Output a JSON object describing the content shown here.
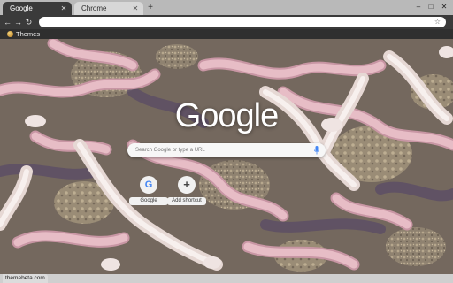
{
  "tabs": [
    {
      "title": "Google",
      "active": true
    },
    {
      "title": "Chrome",
      "active": false
    }
  ],
  "toolbar": {
    "back_icon": "arrow-left-icon",
    "forward_icon": "arrow-right-icon",
    "reload_icon": "reload-icon",
    "omnibox_value": "",
    "star_icon": "star-icon"
  },
  "bookmarks": [
    {
      "label": "Themes",
      "icon": "theme-icon"
    }
  ],
  "ntp": {
    "logo": "Google",
    "search_placeholder": "Search Google or type a URL",
    "shortcuts": [
      {
        "label": "Google",
        "icon": "google-icon",
        "glyph": "G"
      },
      {
        "label": "Add shortcut",
        "icon": "plus-icon",
        "glyph": "+"
      }
    ]
  },
  "status_bar": {
    "text": "themebeta.com"
  },
  "colors": {
    "tabstrip": "#b9b9b9",
    "toolbar": "#3a3a3a",
    "worm": "#e7bdc6",
    "soil": "#a99a82",
    "google_blue": "#4285f4"
  }
}
